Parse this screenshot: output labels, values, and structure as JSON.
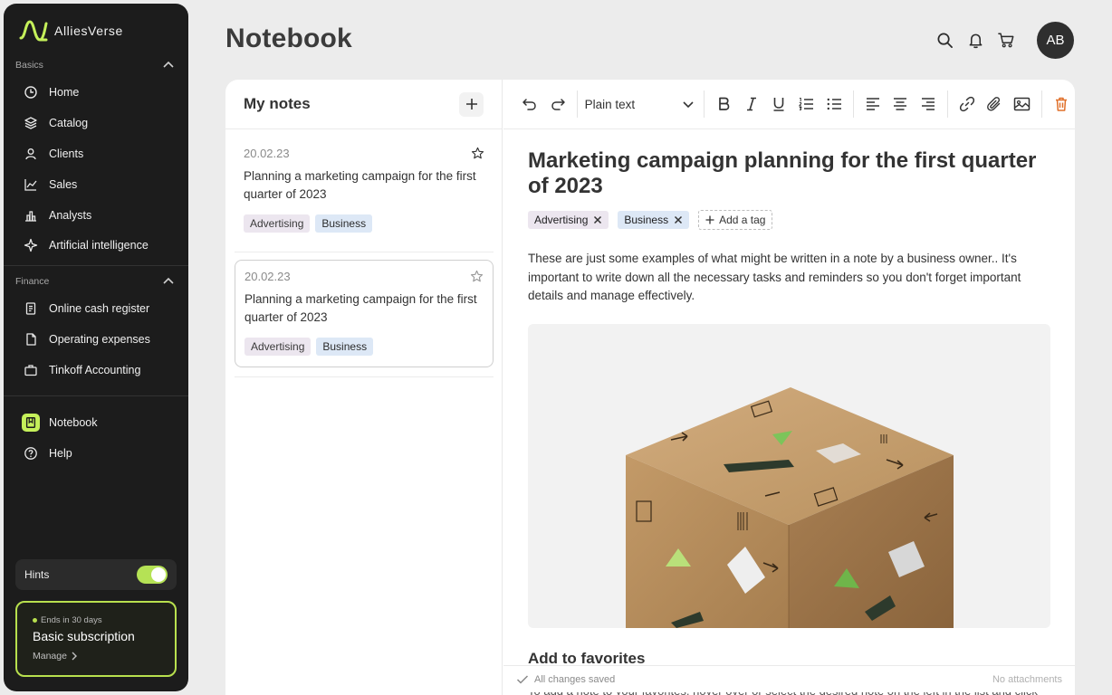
{
  "app": {
    "name": "AlliesVerse",
    "page_title": "Notebook"
  },
  "sidebar": {
    "basics_label": "Basics",
    "finance_label": "Finance",
    "basics_items": [
      {
        "label": "Home",
        "icon": "clock-icon"
      },
      {
        "label": "Catalog",
        "icon": "layers-icon"
      },
      {
        "label": "Clients",
        "icon": "user-icon"
      },
      {
        "label": "Sales",
        "icon": "chart-line-icon"
      },
      {
        "label": "Analysts",
        "icon": "bar-chart-icon"
      },
      {
        "label": "Artificial intelligence",
        "icon": "sparkle-icon"
      }
    ],
    "finance_items": [
      {
        "label": "Online cash register",
        "icon": "receipt-icon"
      },
      {
        "label": "Operating expenses",
        "icon": "document-icon"
      },
      {
        "label": "Tinkoff Accounting",
        "icon": "briefcase-icon"
      }
    ],
    "bottom_items": [
      {
        "label": "Notebook",
        "icon": "notebook-icon",
        "active": true
      },
      {
        "label": "Help",
        "icon": "help-icon"
      }
    ],
    "hints_label": "Hints",
    "hints_on": true,
    "subscription": {
      "ends": "Ends in 30 days",
      "title": "Basic subscription",
      "manage": "Manage"
    }
  },
  "header": {
    "avatar_initials": "AB"
  },
  "notes": {
    "title": "My notes",
    "items": [
      {
        "date": "20.02.23",
        "title": "Planning a marketing campaign for the first quarter of 2023",
        "tags": [
          "Advertising",
          "Business"
        ]
      },
      {
        "date": "20.02.23",
        "title": "Planning a marketing campaign for the first quarter of 2023",
        "tags": [
          "Advertising",
          "Business"
        ]
      }
    ]
  },
  "editor": {
    "format": "Plain text",
    "title": "Marketing campaign planning for the first quarter of 2023",
    "tags": [
      "Advertising",
      "Business"
    ],
    "add_tag": "Add a tag",
    "body": "These are just some examples of what might be written in a note by a business owner.. It's important to write down all the necessary tasks and reminders so you don't forget important details and manage effectively.",
    "subheading": "Add to favorites",
    "cut_text": "To add a note to your favorites, hover over or select the desired note on the left in the list and click",
    "status_saved": "All changes saved",
    "status_attachments": "No attachments"
  },
  "colors": {
    "accent": "#c5f05a",
    "sidebar_bg": "#1c1c1c",
    "delete": "#e0702a"
  }
}
